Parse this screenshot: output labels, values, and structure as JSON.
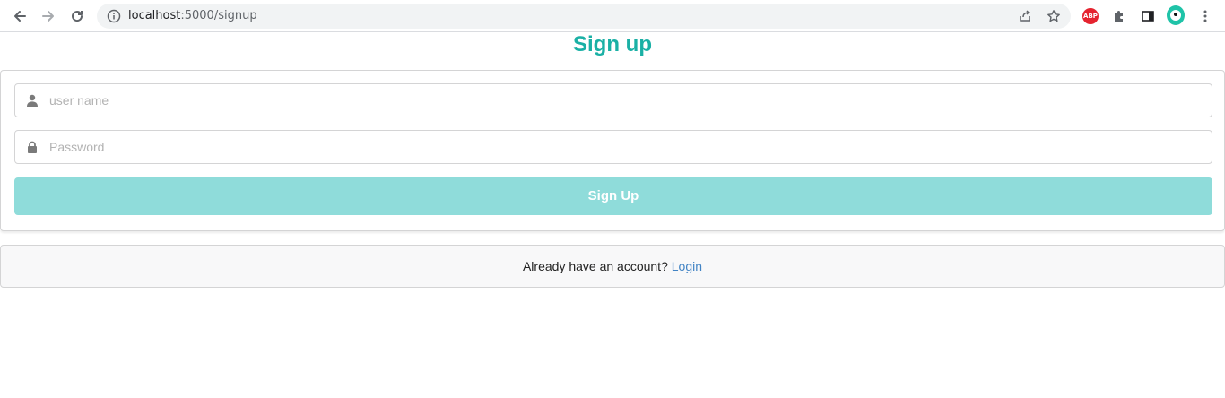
{
  "browser": {
    "url_host": "localhost",
    "url_path": ":5000/signup",
    "extensions": [
      {
        "icon": "adblock-plus-icon",
        "label": "ABP"
      },
      {
        "icon": "puzzle-extension-icon"
      },
      {
        "icon": "side-panel-icon"
      },
      {
        "icon": "profile-avatar-icon"
      },
      {
        "icon": "kebab-menu-icon"
      }
    ]
  },
  "page": {
    "title": "Sign up"
  },
  "form": {
    "username": {
      "placeholder": "user name",
      "icon": "user-icon",
      "value": ""
    },
    "password": {
      "placeholder": "Password",
      "icon": "lock-icon",
      "value": ""
    },
    "submit_label": "Sign Up"
  },
  "message": {
    "text": "Already have an account?",
    "link_label": "Login"
  },
  "colors": {
    "accent": "#1ab0a5",
    "button": "#8fdcda",
    "link": "#4183c4"
  }
}
